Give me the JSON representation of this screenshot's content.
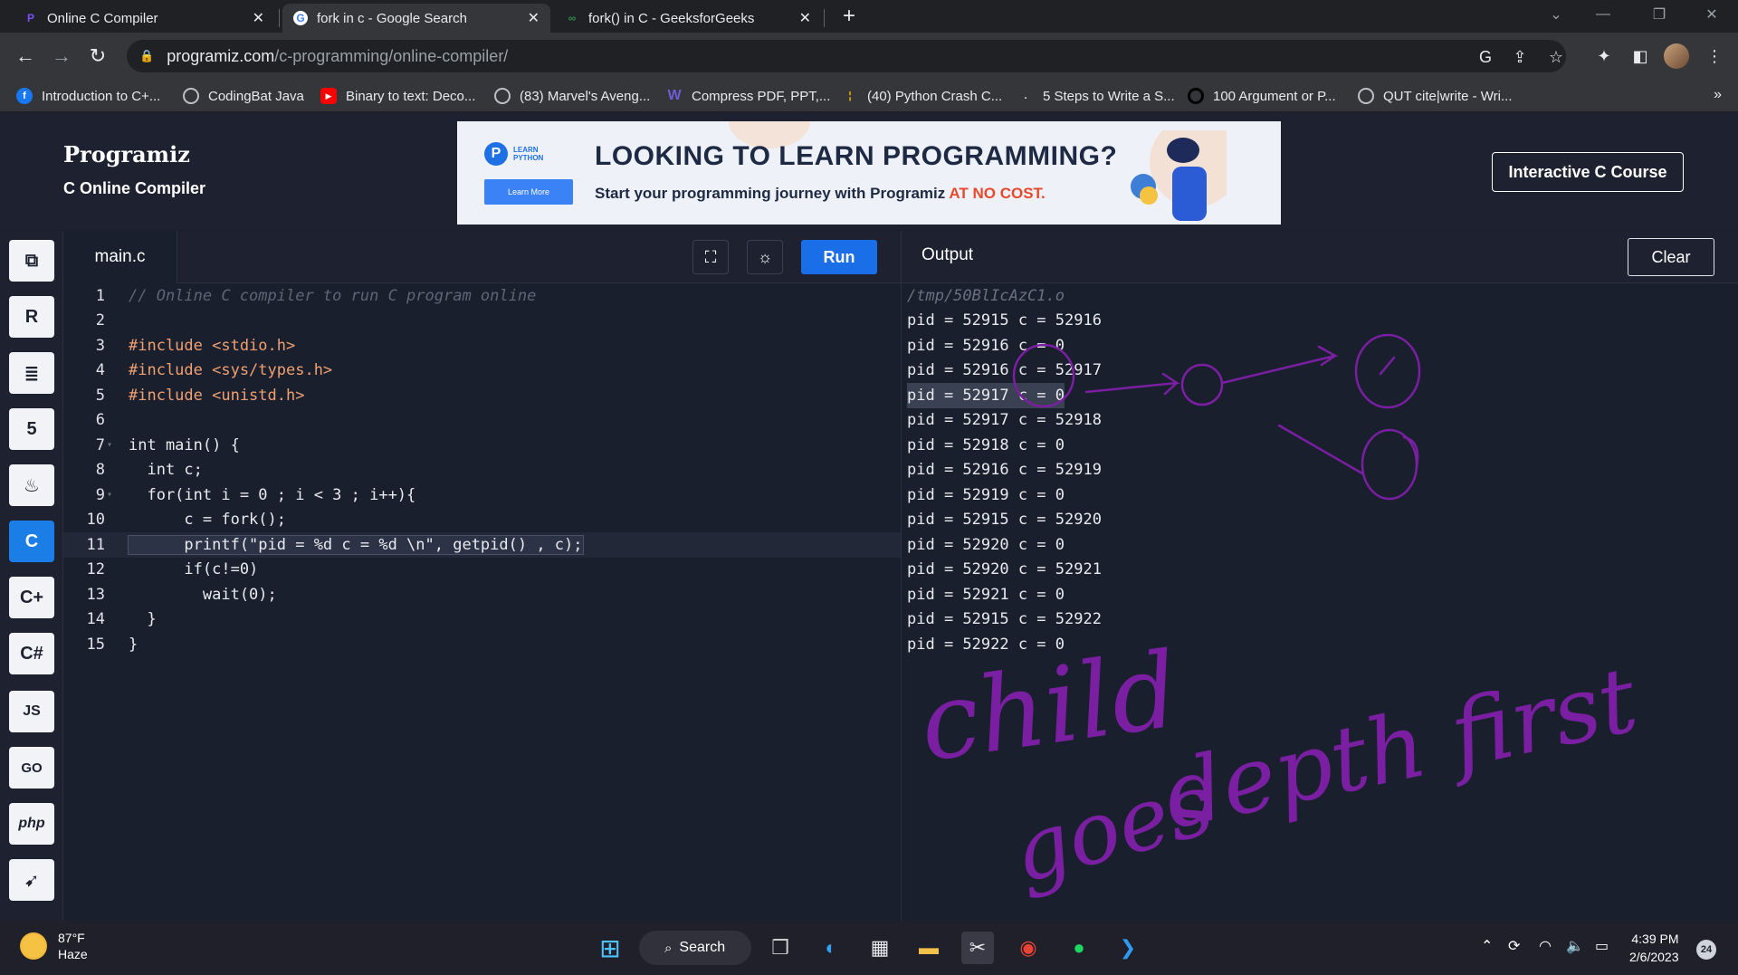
{
  "browser": {
    "tabs": [
      {
        "title": "Online C Compiler",
        "icon": "programiz-icon"
      },
      {
        "title": "fork in c - Google Search",
        "icon": "google-icon"
      },
      {
        "title": "fork() in C - GeeksforGeeks",
        "icon": "geeksforgeeks-icon"
      }
    ],
    "url_host": "programiz.com",
    "url_path": "/c-programming/online-compiler/",
    "bookmarks": [
      {
        "label": "Introduction to C+...",
        "icon": "facebook-icon"
      },
      {
        "label": "CodingBat Java",
        "icon": "globe-icon"
      },
      {
        "label": "Binary to text: Deco...",
        "icon": "youtube-icon"
      },
      {
        "label": "(83) Marvel's Aveng...",
        "icon": "globe-icon"
      },
      {
        "label": "Compress PDF, PPT,...",
        "icon": "w-icon"
      },
      {
        "label": "(40) Python Crash C...",
        "icon": "bookmark-icon"
      },
      {
        "label": "5 Steps to Write a S...",
        "icon": "dot-icon"
      },
      {
        "label": "100 Argument or P...",
        "icon": "circle-icon"
      },
      {
        "label": "QUT cite|write - Wri...",
        "icon": "globe-icon"
      }
    ],
    "more_bookmarks": "»"
  },
  "site": {
    "logo": "Programiz",
    "subtitle": "C Online Compiler",
    "banner": {
      "logo_text_1": "LEARN",
      "logo_text_2": "PYTHON",
      "button": "Learn More",
      "headline": "LOOKING TO LEARN PROGRAMMING?",
      "sub": "Start your programming journey with Programiz ",
      "sub_highlight": "AT NO COST."
    },
    "course_button": "Interactive C Course"
  },
  "sidebar": {
    "items": [
      {
        "name": "python",
        "icon": "python-icon"
      },
      {
        "name": "r",
        "icon": "r-icon"
      },
      {
        "name": "sql",
        "icon": "database-icon"
      },
      {
        "name": "html",
        "icon": "html5-icon"
      },
      {
        "name": "java",
        "icon": "java-icon"
      },
      {
        "name": "c",
        "icon": "c-icon",
        "active": true
      },
      {
        "name": "cpp",
        "icon": "cplusplus-icon"
      },
      {
        "name": "csharp",
        "icon": "csharp-icon"
      },
      {
        "name": "js",
        "icon": "js-icon",
        "label": "JS"
      },
      {
        "name": "go",
        "icon": "go-icon",
        "label": "GO"
      },
      {
        "name": "php",
        "icon": "php-icon",
        "label": "php"
      },
      {
        "name": "swift",
        "icon": "swift-icon"
      }
    ]
  },
  "editor": {
    "filename": "main.c",
    "run_label": "Run",
    "lines": [
      {
        "n": "1",
        "text": "// Online C compiler to run C program online"
      },
      {
        "n": "2",
        "text": ""
      },
      {
        "n": "3",
        "text": "#include <stdio.h>"
      },
      {
        "n": "4",
        "text": "#include <sys/types.h>"
      },
      {
        "n": "5",
        "text": "#include <unistd.h>"
      },
      {
        "n": "6",
        "text": ""
      },
      {
        "n": "7",
        "text": "int main() {"
      },
      {
        "n": "8",
        "text": "  int c;"
      },
      {
        "n": "9",
        "text": "  for(int i = 0 ; i < 3 ; i++){"
      },
      {
        "n": "10",
        "text": "      c = fork();"
      },
      {
        "n": "11",
        "text": "      printf(\"pid = %d c = %d \\n\", getpid() , c);"
      },
      {
        "n": "12",
        "text": "      if(c!=0)"
      },
      {
        "n": "13",
        "text": "        wait(0);"
      },
      {
        "n": "14",
        "text": "  }"
      },
      {
        "n": "15",
        "text": "}"
      }
    ]
  },
  "output": {
    "title": "Output",
    "clear_label": "Clear",
    "path": "/tmp/50BlIcAzC1.o",
    "lines": [
      "pid = 52915 c = 52916",
      "pid = 52916 c = 0",
      "pid = 52916 c = 52917",
      "pid = 52917 c = 0",
      "pid = 52917 c = 52918",
      "pid = 52918 c = 0",
      "pid = 52916 c = 52919",
      "pid = 52919 c = 0",
      "pid = 52915 c = 52920",
      "pid = 52920 c = 0",
      "pid = 52920 c = 52921",
      "pid = 52921 c = 0",
      "pid = 52915 c = 52922",
      "pid = 52922 c = 0"
    ],
    "handwriting": "child goes depth first"
  },
  "taskbar": {
    "temperature": "87°F",
    "condition": "Haze",
    "search_label": "Search",
    "time": "4:39 PM",
    "date": "2/6/2023",
    "notifications": "24"
  },
  "colors": {
    "accent": "#1a6ee8",
    "background": "#1a1f2e",
    "header": "#1e2230",
    "ink": "#7a1fa2"
  }
}
